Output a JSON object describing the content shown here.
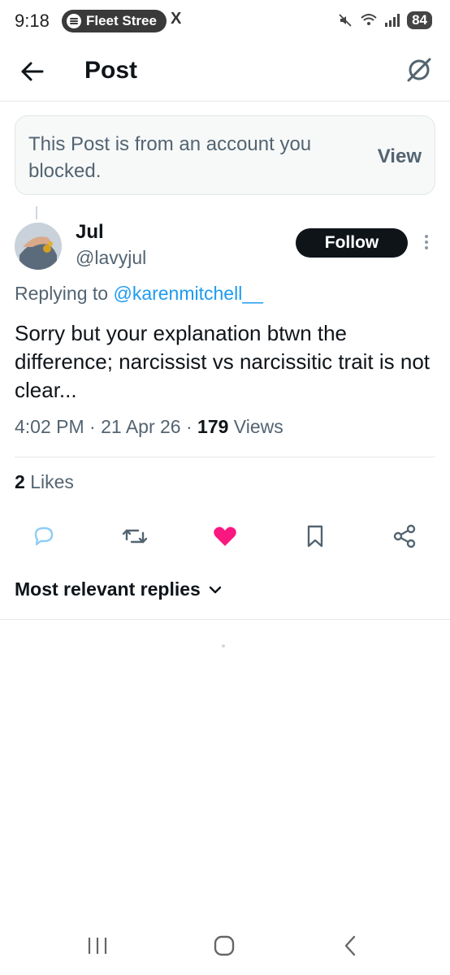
{
  "status_bar": {
    "time": "9:18",
    "media_pill_label": "Fleet Stree",
    "app_glyph": "X",
    "battery": "84"
  },
  "header": {
    "title": "Post"
  },
  "blocked_notice": {
    "text": "This Post is from an account you blocked.",
    "view_label": "View"
  },
  "post": {
    "author_name": "Jul",
    "author_handle": "@lavyjul",
    "follow_label": "Follow",
    "replying_prefix": "Replying to",
    "replying_to": "@karenmitchell__",
    "text": "Sorry but your explanation btwn the difference; narcissist vs narcissitic trait is not clear...",
    "time": "4:02 PM",
    "date": "21 Apr 26",
    "views_count": "179",
    "views_label": "Views",
    "likes_count": "2",
    "likes_label": "Likes",
    "liked": true
  },
  "replies": {
    "sort_label": "Most relevant replies"
  },
  "colors": {
    "accent": "#1d9bf0",
    "like": "#f91880",
    "text_secondary": "#536471"
  }
}
